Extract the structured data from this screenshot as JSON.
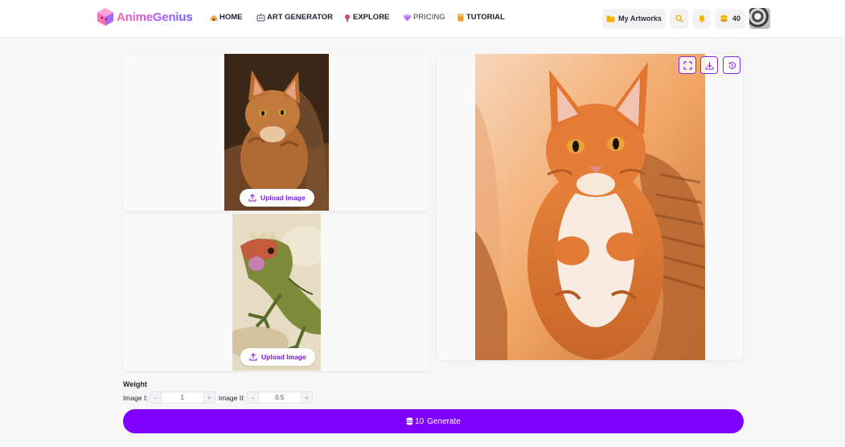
{
  "brand": {
    "name": "AnimeGenius"
  },
  "nav": {
    "items": [
      {
        "label": "HOME",
        "icon": "home-icon"
      },
      {
        "label": "ART GENERATOR",
        "icon": "art-generator-icon"
      },
      {
        "label": "EXPLORE",
        "icon": "explore-icon"
      },
      {
        "label": "PRICING",
        "icon": "diamond-icon"
      },
      {
        "label": "TUTORIAL",
        "icon": "book-icon"
      }
    ],
    "my_artworks": "My Artworks",
    "credits": "40"
  },
  "uploads": {
    "image1_button": "Upload Image",
    "image2_button": "Upload Image"
  },
  "weight": {
    "title": "Weight",
    "image1_label": "Image I:",
    "image1_value": "1",
    "image2_label": "Image II:",
    "image2_value": "0.5",
    "minus": "−",
    "plus": "+"
  },
  "generate": {
    "cost": "10",
    "label": "Generate"
  },
  "colors": {
    "accent": "#7f00ff",
    "accent_text": "#7c16e6",
    "folder": "#f5b400",
    "coin": "#f5b400"
  }
}
